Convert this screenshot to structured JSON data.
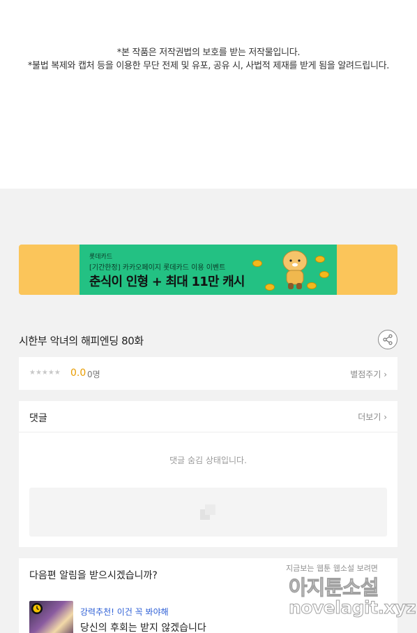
{
  "notice": {
    "line1": "*본 작품은 저작권법의 보호를 받는 저작물입니다.",
    "line2": "*불법 복제와 캡처 등을 이용한 무단 전제 및 유포, 공유 시, 사법적 제재를 받게 됨을 알려드립니다."
  },
  "banner": {
    "brand": "롯데카드",
    "subtitle": "[기간한정] 카카오페이지 롯데카드 이용 이벤트",
    "title": "춘식이 인형 + 최대 11만 캐시",
    "colors": {
      "outer": "#fbc55a",
      "inner": "#23c183"
    }
  },
  "episode": {
    "title": "시한부 악녀의 해피엔딩 80화",
    "share_icon": "share-icon"
  },
  "rating": {
    "stars": "★★★★★",
    "score": "0.0",
    "count": "0명",
    "rate_link": "별점주기 ›"
  },
  "comments": {
    "title": "댓글",
    "more": "더보기 ›",
    "hidden_message": "댓글 숨김 상태입니다.",
    "placeholder_icon": "comment-placeholder-icon"
  },
  "alert": {
    "title": "다음편 알림을 받으시겠습니까?",
    "recommend_badge": "강력추천! 이건 꼭 봐야해",
    "recommend_title": "당신의 후회는 받지 않겠습니다",
    "badge_color": "#2d5fd6"
  },
  "watermark": {
    "line1": "지금보는 웹툰 웹소설 보려면",
    "line2": "아지툰소설",
    "line3": "novelagit.xyz"
  }
}
